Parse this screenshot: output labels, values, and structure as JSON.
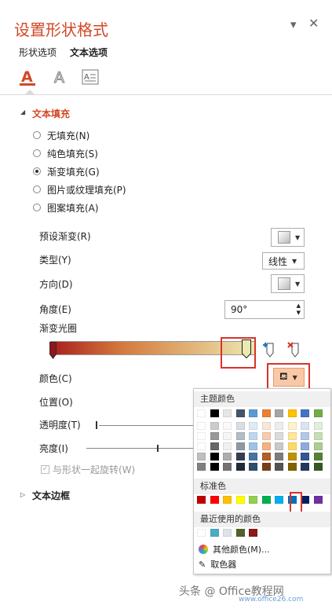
{
  "pane": {
    "title": "设置形状格式",
    "tabs": [
      "形状选项",
      "文本选项"
    ],
    "section_fill": "文本填充",
    "fill_options": [
      "无填充(N)",
      "纯色填充(S)",
      "渐变填充(G)",
      "图片或纹理填充(P)",
      "图案填充(A)"
    ],
    "selected_fill": "渐变填充(G)",
    "preset_label": "预设渐变(R)",
    "type_label": "类型(Y)",
    "type_value": "线性",
    "direction_label": "方向(D)",
    "angle_label": "角度(E)",
    "angle_value": "90°",
    "stops_label": "渐变光圈",
    "color_label": "颜色(C)",
    "position_label": "位置(O)",
    "transparency_label": "透明度(T)",
    "brightness_label": "亮度(I)",
    "rotate_label": "与形状一起旋转(W)",
    "section_border": "文本边框"
  },
  "gradient_colors": [
    "#a81f1f",
    "#d47a3d",
    "#ece8b0"
  ],
  "accent": "#d24726",
  "color_popup": {
    "theme_header": "主题颜色",
    "standard_header": "标准色",
    "recent_header": "最近使用的颜色",
    "more_colors": "其他颜色(M)...",
    "eyedropper": "取色器",
    "theme_top": [
      "#ffffff",
      "#000000",
      "#e7e6e6",
      "#44546a",
      "#5b9bd5",
      "#ed7d31",
      "#a5a5a5",
      "#ffc000",
      "#4472c4",
      "#70ad47"
    ],
    "standard": [
      "#c00000",
      "#ff0000",
      "#ffc000",
      "#ffff00",
      "#92d050",
      "#00b050",
      "#00b0f0",
      "#0070c0",
      "#002060",
      "#7030a0"
    ],
    "recent": [
      "#ffffff",
      "#4bacc6",
      "#dfe3e8",
      "#4f6228",
      "#8b1a1a"
    ]
  },
  "watermark": {
    "text": "头条 @ Office教程网",
    "site": "www.office26.com"
  }
}
